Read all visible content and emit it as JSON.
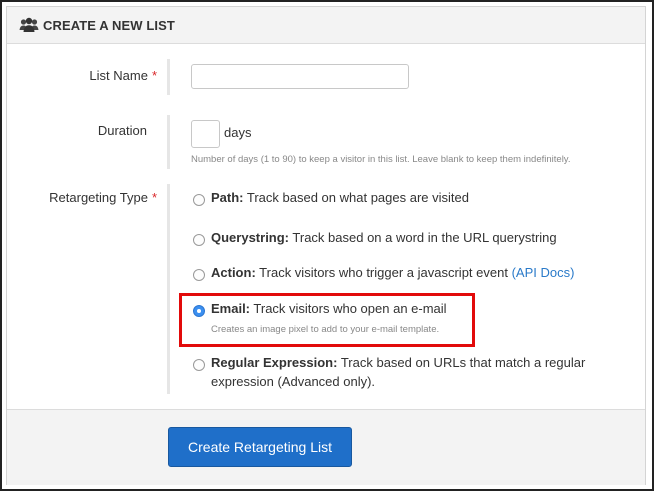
{
  "header": {
    "title": "CREATE A NEW LIST",
    "icon": "users-icon"
  },
  "fields": {
    "list_name": {
      "label": "List Name",
      "required_mark": "*",
      "value": ""
    },
    "duration": {
      "label": "Duration",
      "value": "",
      "unit": "days",
      "help": "Number of days (1 to 90) to keep a visitor in this list. Leave blank to keep them indefinitely."
    },
    "retargeting_type": {
      "label": "Retargeting Type",
      "required_mark": "*",
      "selected": "email",
      "options": [
        {
          "id": "path",
          "title": "Path:",
          "desc": "Track based on what pages are visited"
        },
        {
          "id": "querystring",
          "title": "Querystring:",
          "desc": "Track based on a word in the URL querystring"
        },
        {
          "id": "action",
          "title": "Action:",
          "desc": "Track visitors who trigger a javascript event",
          "link": "(API Docs)"
        },
        {
          "id": "email",
          "title": "Email:",
          "desc": "Track visitors who open an e-mail",
          "help": "Creates an image pixel to add to your e-mail template."
        },
        {
          "id": "regex",
          "title": "Regular Expression:",
          "desc": "Track based on URLs that match a regular",
          "desc2": "expression (Advanced only)."
        }
      ]
    }
  },
  "submit": {
    "label": "Create Retargeting List"
  },
  "colors": {
    "primary": "#1f6fc9",
    "highlight": "#e20a0a",
    "required": "#d9262a",
    "link": "#2a7ac9"
  }
}
